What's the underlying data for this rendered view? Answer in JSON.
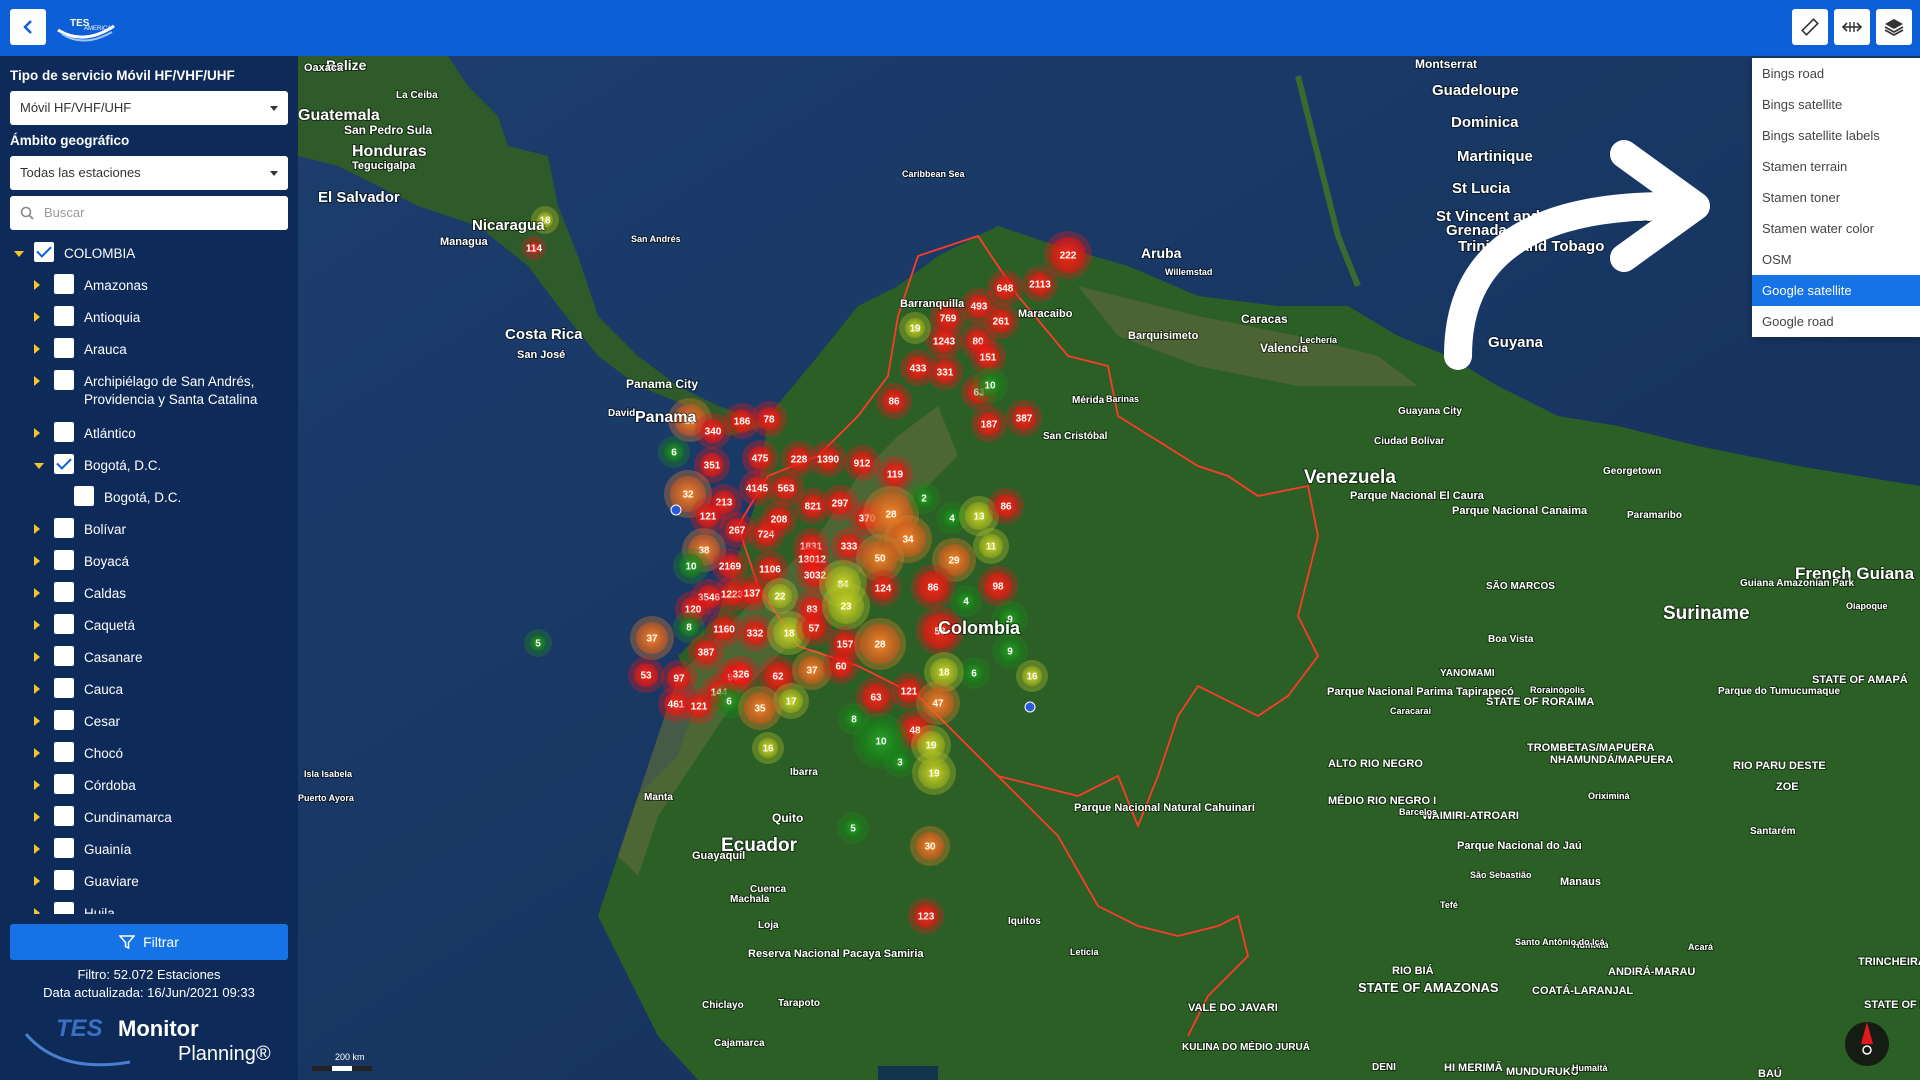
{
  "sidebar": {
    "service_type_label": "Tipo de servicio Móvil HF/VHF/UHF",
    "service_type_value": "Móvil HF/VHF/UHF",
    "geo_scope_label": "Ámbito geográfico",
    "geo_scope_value": "Todas las estaciones",
    "search_placeholder": "Buscar",
    "tree": [
      {
        "label": "COLOMBIA",
        "checked": true,
        "expanded": true,
        "level": 0
      },
      {
        "label": "Amazonas",
        "checked": false,
        "level": 1
      },
      {
        "label": "Antioquia",
        "checked": false,
        "level": 1
      },
      {
        "label": "Arauca",
        "checked": false,
        "level": 1
      },
      {
        "label": "Archipiélago de San Andrés,",
        "label2": "Providencia y Santa Catalina",
        "checked": false,
        "level": 1
      },
      {
        "label": "Atlántico",
        "checked": false,
        "level": 1
      },
      {
        "label": "Bogotá, D.C.",
        "checked": true,
        "expanded": true,
        "level": 1
      },
      {
        "label": "Bogotá, D.C.",
        "checked": false,
        "level": 2
      },
      {
        "label": "Bolívar",
        "checked": false,
        "level": 1
      },
      {
        "label": "Boyacá",
        "checked": false,
        "level": 1
      },
      {
        "label": "Caldas",
        "checked": false,
        "level": 1
      },
      {
        "label": "Caquetá",
        "checked": false,
        "level": 1
      },
      {
        "label": "Casanare",
        "checked": false,
        "level": 1
      },
      {
        "label": "Cauca",
        "checked": false,
        "level": 1
      },
      {
        "label": "Cesar",
        "checked": false,
        "level": 1
      },
      {
        "label": "Chocó",
        "checked": false,
        "level": 1
      },
      {
        "label": "Córdoba",
        "checked": false,
        "level": 1
      },
      {
        "label": "Cundinamarca",
        "checked": false,
        "level": 1
      },
      {
        "label": "Guainía",
        "checked": false,
        "level": 1
      },
      {
        "label": "Guaviare",
        "checked": false,
        "level": 1
      },
      {
        "label": "Huila",
        "checked": false,
        "level": 1
      }
    ],
    "filter_button": "Filtrar",
    "filter_status": "Filtro: 52.072 Estaciones",
    "updated": "Data actualizada: 16/Jun/2021 09:33",
    "brand_tes": "TES",
    "brand_monitor": "Monitor",
    "brand_planning": "Planning®"
  },
  "layer_menu": {
    "items": [
      "Bings road",
      "Bings satellite",
      "Bings satellite labels",
      "Stamen terrain",
      "Stamen toner",
      "Stamen water color",
      "OSM",
      "Google satellite",
      "Google road"
    ],
    "selected": "Google satellite"
  },
  "map": {
    "scale_label": "200 km",
    "labels": [
      "Belize",
      "Oaxaca",
      "Guatemala",
      "La Ceiba",
      "San Pedro Sula",
      "Honduras",
      "Tegucigalpa",
      "El Salvador",
      "Nicaragua",
      "Managua",
      "Costa Rica",
      "San José",
      "Panama City",
      "Panama",
      "David",
      "Caribbean Sea",
      "Aruba",
      "Willemstad",
      "Barranquilla",
      "Maracaibo",
      "Barquisimeto",
      "Caracas",
      "Valencia",
      "Venezuela",
      "Mérida",
      "Barinas",
      "San Cristóbal",
      "Colombia",
      "Ecuador",
      "Quito",
      "Manta",
      "Guayaquil",
      "Ibarra",
      "Cuenca",
      "Machala",
      "Loja",
      "Iquitos",
      "Montserrat",
      "Guadeloupe",
      "Dominica",
      "Martinique",
      "St Lucia",
      "St Vincent and the Grenadines",
      "Grenada",
      "Trinidad and Tobago",
      "Guyana",
      "Georgetown",
      "Suriname",
      "Paramaribo",
      "French Guiana",
      "Ciudad Bolívar",
      "Guayana City",
      "Lechería",
      "Boa Vista",
      "Manaus",
      "Puerto Ayora",
      "Isla Isabela",
      "San Andrés",
      "Letícia",
      "Tarapoto",
      "Cajamarca",
      "Chiclayo",
      "Santarém",
      "Parque Nacional Canaima",
      "Parque Nacional El Caura",
      "Parque Nacional Parima Tapirapecó",
      "Parque Nacional do Jaú",
      "Parque Nacional Natural Cahuinarí",
      "Reserva Nacional Pacaya Samiria",
      "Guiana Amazonian Park",
      "Parque do Tumucumaque",
      "YANOMAMI",
      "STATE OF RORAIMA",
      "ALTO RIO NEGRO",
      "MÉDIO RIO NEGRO I",
      "RIO BIÁ",
      "STATE OF AMAZONAS",
      "VALE DO JAVARI",
      "KULINA DO MÉDIO JURUÁ",
      "DENI",
      "HI MERIMÃ",
      "MUNDURUKU",
      "BAÚ",
      "COATÁ-LARANJAL",
      "ANDIRÁ-MARAU",
      "TROMBETAS/MAPUERA",
      "NHAMUNDÁ/MAPUERA",
      "WAIMIRI-ATROARI",
      "RIO PARU DESTE",
      "ZOE",
      "STATE OF AMAPÁ",
      "STATE OF PARÁ",
      "TRINCHEIRA BACAJÁ",
      "SÃO MARCOS",
      "Oiapoque",
      "Rorainópolis",
      "Barcelos",
      "Tefé",
      "Humaitá",
      "Santo Antônio do Içá",
      "São Sebastião",
      "Oriximiná",
      "Caracaraí",
      "Acará",
      "Humaitá"
    ],
    "clusters": [
      {
        "n": "222",
        "c": "red"
      },
      {
        "n": "2113",
        "c": "red"
      },
      {
        "n": "648",
        "c": "red"
      },
      {
        "n": "493",
        "c": "red"
      },
      {
        "n": "769",
        "c": "red"
      },
      {
        "n": "261",
        "c": "red"
      },
      {
        "n": "1243",
        "c": "red"
      },
      {
        "n": "80",
        "c": "red"
      },
      {
        "n": "19",
        "c": "yellow"
      },
      {
        "n": "151",
        "c": "red"
      },
      {
        "n": "433",
        "c": "red"
      },
      {
        "n": "331",
        "c": "red"
      },
      {
        "n": "63",
        "c": "red"
      },
      {
        "n": "10",
        "c": "green"
      },
      {
        "n": "86",
        "c": "red"
      },
      {
        "n": "29",
        "c": "orange"
      },
      {
        "n": "340",
        "c": "red"
      },
      {
        "n": "186",
        "c": "red"
      },
      {
        "n": "78",
        "c": "red"
      },
      {
        "n": "187",
        "c": "red"
      },
      {
        "n": "387",
        "c": "red"
      },
      {
        "n": "6",
        "c": "green"
      },
      {
        "n": "351",
        "c": "red"
      },
      {
        "n": "475",
        "c": "red"
      },
      {
        "n": "228",
        "c": "red"
      },
      {
        "n": "1390",
        "c": "red"
      },
      {
        "n": "912",
        "c": "red"
      },
      {
        "n": "119",
        "c": "red"
      },
      {
        "n": "32",
        "c": "orange"
      },
      {
        "n": "4145",
        "c": "red"
      },
      {
        "n": "563",
        "c": "red"
      },
      {
        "n": "213",
        "c": "red"
      },
      {
        "n": "821",
        "c": "red"
      },
      {
        "n": "297",
        "c": "red"
      },
      {
        "n": "370",
        "c": "red"
      },
      {
        "n": "28",
        "c": "orange"
      },
      {
        "n": "2",
        "c": "green"
      },
      {
        "n": "4",
        "c": "green"
      },
      {
        "n": "13",
        "c": "yellow"
      },
      {
        "n": "86",
        "c": "red"
      },
      {
        "n": "121",
        "c": "red"
      },
      {
        "n": "267",
        "c": "red"
      },
      {
        "n": "724",
        "c": "red"
      },
      {
        "n": "208",
        "c": "red"
      },
      {
        "n": "1831",
        "c": "red"
      },
      {
        "n": "333",
        "c": "red"
      },
      {
        "n": "34",
        "c": "orange"
      },
      {
        "n": "11",
        "c": "yellow"
      },
      {
        "n": "38",
        "c": "orange"
      },
      {
        "n": "10",
        "c": "green"
      },
      {
        "n": "2169",
        "c": "red"
      },
      {
        "n": "1106",
        "c": "red"
      },
      {
        "n": "13012",
        "c": "red"
      },
      {
        "n": "50",
        "c": "orange"
      },
      {
        "n": "29",
        "c": "orange"
      },
      {
        "n": "3032",
        "c": "red"
      },
      {
        "n": "3546",
        "c": "red"
      },
      {
        "n": "1223",
        "c": "red"
      },
      {
        "n": "137",
        "c": "red"
      },
      {
        "n": "22",
        "c": "yellow"
      },
      {
        "n": "83",
        "c": "red"
      },
      {
        "n": "84",
        "c": "yellow"
      },
      {
        "n": "124",
        "c": "red"
      },
      {
        "n": "86",
        "c": "red"
      },
      {
        "n": "98",
        "c": "red"
      },
      {
        "n": "120",
        "c": "red"
      },
      {
        "n": "4",
        "c": "green"
      },
      {
        "n": "5",
        "c": "green"
      },
      {
        "n": "8",
        "c": "green"
      },
      {
        "n": "1160",
        "c": "red"
      },
      {
        "n": "332",
        "c": "red"
      },
      {
        "n": "18",
        "c": "yellow"
      },
      {
        "n": "57",
        "c": "red"
      },
      {
        "n": "23",
        "c": "yellow"
      },
      {
        "n": "58",
        "c": "red"
      },
      {
        "n": "9",
        "c": "green"
      },
      {
        "n": "37",
        "c": "orange"
      },
      {
        "n": "387",
        "c": "red"
      },
      {
        "n": "157",
        "c": "red"
      },
      {
        "n": "28",
        "c": "orange"
      },
      {
        "n": "9",
        "c": "green"
      },
      {
        "n": "93",
        "c": "red"
      },
      {
        "n": "6",
        "c": "green"
      },
      {
        "n": "53",
        "c": "red"
      },
      {
        "n": "97",
        "c": "red"
      },
      {
        "n": "326",
        "c": "red"
      },
      {
        "n": "62",
        "c": "red"
      },
      {
        "n": "37",
        "c": "orange"
      },
      {
        "n": "60",
        "c": "red"
      },
      {
        "n": "18",
        "c": "yellow"
      },
      {
        "n": "16",
        "c": "yellow"
      },
      {
        "n": "144",
        "c": "red"
      },
      {
        "n": "17",
        "c": "yellow"
      },
      {
        "n": "63",
        "c": "red"
      },
      {
        "n": "121",
        "c": "red"
      },
      {
        "n": "47",
        "c": "orange"
      },
      {
        "n": "461",
        "c": "red"
      },
      {
        "n": "121",
        "c": "red"
      },
      {
        "n": "6",
        "c": "green"
      },
      {
        "n": "35",
        "c": "orange"
      },
      {
        "n": "8",
        "c": "green"
      },
      {
        "n": "48",
        "c": "red"
      },
      {
        "n": "16",
        "c": "yellow"
      },
      {
        "n": "10",
        "c": "green"
      },
      {
        "n": "19",
        "c": "yellow"
      },
      {
        "n": "3",
        "c": "green"
      },
      {
        "n": "19",
        "c": "yellow"
      },
      {
        "n": "5",
        "c": "green"
      },
      {
        "n": "30",
        "c": "orange"
      },
      {
        "n": "123",
        "c": "red"
      },
      {
        "n": "18",
        "c": "yellow"
      },
      {
        "n": "114",
        "c": "red"
      }
    ]
  },
  "colors": {
    "topbar": "#0c5fd6",
    "sidebar": "#0d2a58",
    "accent": "#1673e6",
    "red": "#e31a1c",
    "orange": "#e87d2a",
    "yellow": "#b8c22a",
    "green": "#1e8a1e"
  },
  "icons": {
    "back": "chevron-left-icon",
    "ruler": "ruler-icon",
    "measure": "measure-distance-icon",
    "layers": "layers-icon",
    "search": "search-icon",
    "filter": "filter-icon",
    "compass": "compass-icon"
  }
}
